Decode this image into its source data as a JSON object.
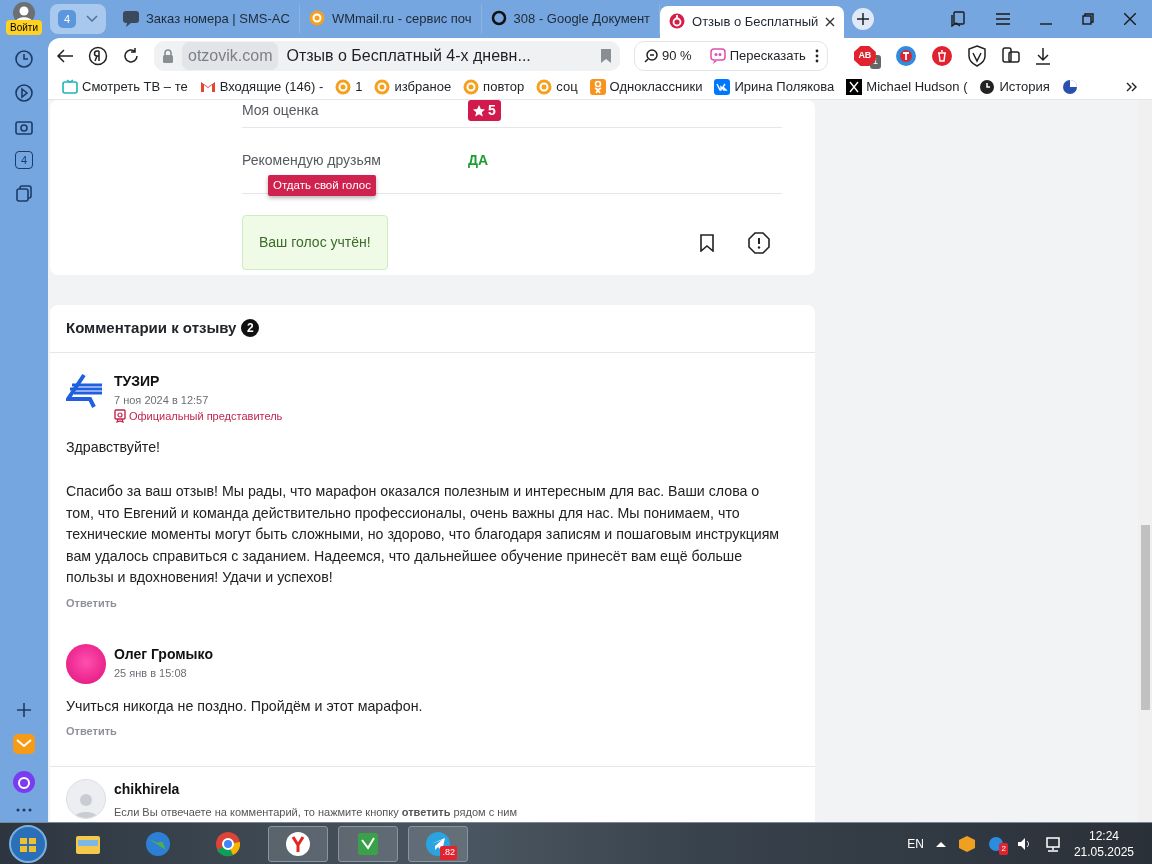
{
  "browser": {
    "profile_button": "Войти",
    "tab_group_count": "4",
    "tabs": [
      {
        "kind": "sms",
        "title": "Заказ номера | SMS-AC",
        "selected": false
      },
      {
        "kind": "mail",
        "title": "WMmail.ru - сервис поч",
        "selected": false
      },
      {
        "kind": "ring",
        "title": "308 - Google Документ",
        "selected": false
      },
      {
        "kind": "review",
        "title": "Отзыв о Бесплатный",
        "selected": true
      }
    ],
    "sidebar_badge": "4",
    "address": {
      "domain": "otzovik.com",
      "page_title": "Отзыв о Бесплатный 4-х дневн..."
    },
    "zoom": "90 %",
    "summarize": "Пересказать",
    "adblock_label": "AB",
    "adblock_badge": "1",
    "bookmarks": [
      {
        "kind": "tv",
        "title": "Смотреть ТВ – те"
      },
      {
        "kind": "gmail",
        "title": "Входящие (146) -"
      },
      {
        "kind": "mail",
        "title": "1"
      },
      {
        "kind": "mail",
        "title": "избраное"
      },
      {
        "kind": "mail",
        "title": "повтор"
      },
      {
        "kind": "mail",
        "title": "соц"
      },
      {
        "kind": "ok",
        "title": "Одноклассники"
      },
      {
        "kind": "vk",
        "title": "Ирина Полякова"
      },
      {
        "kind": "x",
        "title": "Michael Hudson ("
      },
      {
        "kind": "history",
        "title": "История"
      },
      {
        "kind": "drive"
      }
    ]
  },
  "review": {
    "rows": [
      {
        "kind": "rating",
        "label": "Моя оценка",
        "value": "5"
      },
      {
        "kind": "text",
        "label": "Рекомендую друзьям",
        "value": "ДА"
      }
    ],
    "tooltip": "Отдать свой голос",
    "vote_message": "Ваш голос учтён!"
  },
  "comments": {
    "title": "Комментарии к отзыву",
    "count": "2",
    "items": [
      {
        "kind": "official",
        "author": "ТУЗИР",
        "date": "7 ноя 2024 в 12:57",
        "badge": "Официальный представитель",
        "paragraphs": [
          "Здравствуйте!",
          "Спасибо за ваш отзыв! Мы рады, что марафон оказался полезным и интересным для вас. Ваши слова о том, что Евгений и команда действительно профессионалы, очень важны для нас. Мы понимаем, что технические моменты могут быть сложными, но здорово, что благодаря записям и пошаговым инструкциям вам удалось справиться с заданием. Надеемся, что дальнейшее обучение принесёт вам ещё больше пользы и вдохновения! Удачи и успехов!"
        ],
        "reply": "Ответить"
      },
      {
        "kind": "user",
        "author": "Олег Громыко",
        "date": "25 янв в 15:08",
        "paragraphs": [
          "Учиться никогда не поздно. Пройдём и этот марафон."
        ],
        "reply": "Ответить"
      }
    ],
    "form": {
      "author": "chikhirela",
      "hint": "Если Вы отвечаете на комментарий, то нажмите кнопку **ответить** рядом с ним"
    }
  },
  "taskbar": {
    "language": "EN",
    "telegram_badge": ".82",
    "tray_badge": "2",
    "time": "12:24",
    "date": "21.05.2025"
  }
}
